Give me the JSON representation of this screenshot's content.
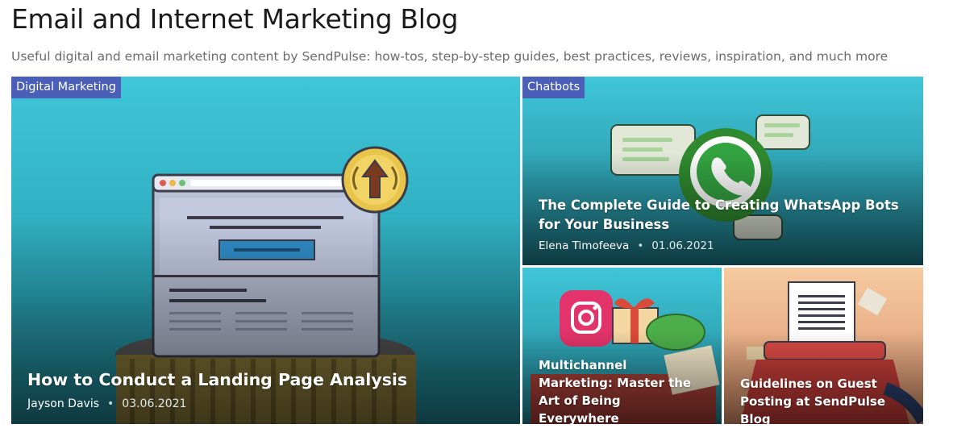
{
  "header": {
    "title": "Email and Internet Marketing Blog",
    "subtitle": "Useful digital and email marketing content by SendPulse: how-tos, step-by-step guides, best practices, reviews, inspiration, and much more"
  },
  "posts": [
    {
      "category": "Digital Marketing",
      "title": "How to Conduct a Landing Page Analysis",
      "author": "Jayson Davis",
      "date": "03.06.2021"
    },
    {
      "category": "Chatbots",
      "title": "The Complete Guide to Creating WhatsApp Bots for Your Business",
      "author": "Elena Timofeeva",
      "date": "01.06.2021"
    },
    {
      "title": "Multichannel Marketing: Master the Art of Being Everywhere"
    },
    {
      "title": "Guidelines on Guest Posting at SendPulse Blog"
    }
  ],
  "colors": {
    "category_badge": "#4a5fb7",
    "card_teal": "#3cc3d6",
    "card_peach": "#f4c49a"
  },
  "icons": {
    "browser": "browser-window-icon",
    "award": "award-medal-icon",
    "whatsapp": "whatsapp-icon",
    "instagram": "instagram-icon",
    "gift": "gift-icon",
    "seo": "seo-badge-icon",
    "typewriter": "typewriter-icon"
  }
}
